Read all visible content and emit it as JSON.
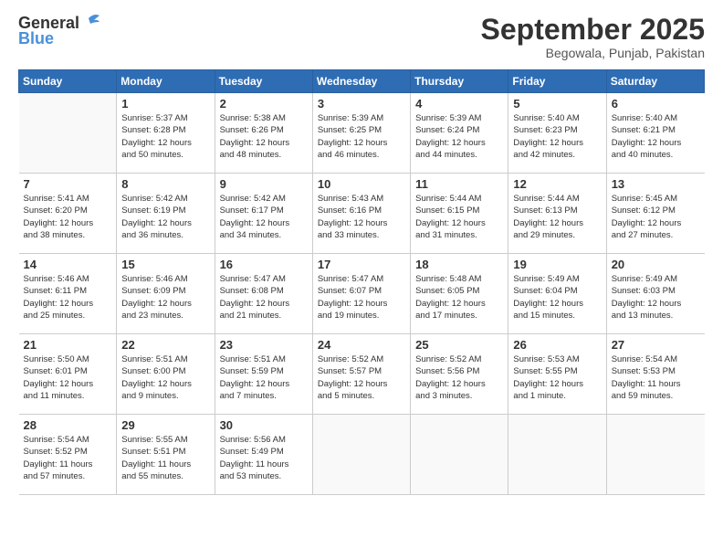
{
  "header": {
    "logo_general": "General",
    "logo_blue": "Blue",
    "month_title": "September 2025",
    "location": "Begowala, Punjab, Pakistan"
  },
  "weekdays": [
    "Sunday",
    "Monday",
    "Tuesday",
    "Wednesday",
    "Thursday",
    "Friday",
    "Saturday"
  ],
  "weeks": [
    [
      {
        "day": "",
        "info": ""
      },
      {
        "day": "1",
        "info": "Sunrise: 5:37 AM\nSunset: 6:28 PM\nDaylight: 12 hours\nand 50 minutes."
      },
      {
        "day": "2",
        "info": "Sunrise: 5:38 AM\nSunset: 6:26 PM\nDaylight: 12 hours\nand 48 minutes."
      },
      {
        "day": "3",
        "info": "Sunrise: 5:39 AM\nSunset: 6:25 PM\nDaylight: 12 hours\nand 46 minutes."
      },
      {
        "day": "4",
        "info": "Sunrise: 5:39 AM\nSunset: 6:24 PM\nDaylight: 12 hours\nand 44 minutes."
      },
      {
        "day": "5",
        "info": "Sunrise: 5:40 AM\nSunset: 6:23 PM\nDaylight: 12 hours\nand 42 minutes."
      },
      {
        "day": "6",
        "info": "Sunrise: 5:40 AM\nSunset: 6:21 PM\nDaylight: 12 hours\nand 40 minutes."
      }
    ],
    [
      {
        "day": "7",
        "info": "Sunrise: 5:41 AM\nSunset: 6:20 PM\nDaylight: 12 hours\nand 38 minutes."
      },
      {
        "day": "8",
        "info": "Sunrise: 5:42 AM\nSunset: 6:19 PM\nDaylight: 12 hours\nand 36 minutes."
      },
      {
        "day": "9",
        "info": "Sunrise: 5:42 AM\nSunset: 6:17 PM\nDaylight: 12 hours\nand 34 minutes."
      },
      {
        "day": "10",
        "info": "Sunrise: 5:43 AM\nSunset: 6:16 PM\nDaylight: 12 hours\nand 33 minutes."
      },
      {
        "day": "11",
        "info": "Sunrise: 5:44 AM\nSunset: 6:15 PM\nDaylight: 12 hours\nand 31 minutes."
      },
      {
        "day": "12",
        "info": "Sunrise: 5:44 AM\nSunset: 6:13 PM\nDaylight: 12 hours\nand 29 minutes."
      },
      {
        "day": "13",
        "info": "Sunrise: 5:45 AM\nSunset: 6:12 PM\nDaylight: 12 hours\nand 27 minutes."
      }
    ],
    [
      {
        "day": "14",
        "info": "Sunrise: 5:46 AM\nSunset: 6:11 PM\nDaylight: 12 hours\nand 25 minutes."
      },
      {
        "day": "15",
        "info": "Sunrise: 5:46 AM\nSunset: 6:09 PM\nDaylight: 12 hours\nand 23 minutes."
      },
      {
        "day": "16",
        "info": "Sunrise: 5:47 AM\nSunset: 6:08 PM\nDaylight: 12 hours\nand 21 minutes."
      },
      {
        "day": "17",
        "info": "Sunrise: 5:47 AM\nSunset: 6:07 PM\nDaylight: 12 hours\nand 19 minutes."
      },
      {
        "day": "18",
        "info": "Sunrise: 5:48 AM\nSunset: 6:05 PM\nDaylight: 12 hours\nand 17 minutes."
      },
      {
        "day": "19",
        "info": "Sunrise: 5:49 AM\nSunset: 6:04 PM\nDaylight: 12 hours\nand 15 minutes."
      },
      {
        "day": "20",
        "info": "Sunrise: 5:49 AM\nSunset: 6:03 PM\nDaylight: 12 hours\nand 13 minutes."
      }
    ],
    [
      {
        "day": "21",
        "info": "Sunrise: 5:50 AM\nSunset: 6:01 PM\nDaylight: 12 hours\nand 11 minutes."
      },
      {
        "day": "22",
        "info": "Sunrise: 5:51 AM\nSunset: 6:00 PM\nDaylight: 12 hours\nand 9 minutes."
      },
      {
        "day": "23",
        "info": "Sunrise: 5:51 AM\nSunset: 5:59 PM\nDaylight: 12 hours\nand 7 minutes."
      },
      {
        "day": "24",
        "info": "Sunrise: 5:52 AM\nSunset: 5:57 PM\nDaylight: 12 hours\nand 5 minutes."
      },
      {
        "day": "25",
        "info": "Sunrise: 5:52 AM\nSunset: 5:56 PM\nDaylight: 12 hours\nand 3 minutes."
      },
      {
        "day": "26",
        "info": "Sunrise: 5:53 AM\nSunset: 5:55 PM\nDaylight: 12 hours\nand 1 minute."
      },
      {
        "day": "27",
        "info": "Sunrise: 5:54 AM\nSunset: 5:53 PM\nDaylight: 11 hours\nand 59 minutes."
      }
    ],
    [
      {
        "day": "28",
        "info": "Sunrise: 5:54 AM\nSunset: 5:52 PM\nDaylight: 11 hours\nand 57 minutes."
      },
      {
        "day": "29",
        "info": "Sunrise: 5:55 AM\nSunset: 5:51 PM\nDaylight: 11 hours\nand 55 minutes."
      },
      {
        "day": "30",
        "info": "Sunrise: 5:56 AM\nSunset: 5:49 PM\nDaylight: 11 hours\nand 53 minutes."
      },
      {
        "day": "",
        "info": ""
      },
      {
        "day": "",
        "info": ""
      },
      {
        "day": "",
        "info": ""
      },
      {
        "day": "",
        "info": ""
      }
    ]
  ]
}
